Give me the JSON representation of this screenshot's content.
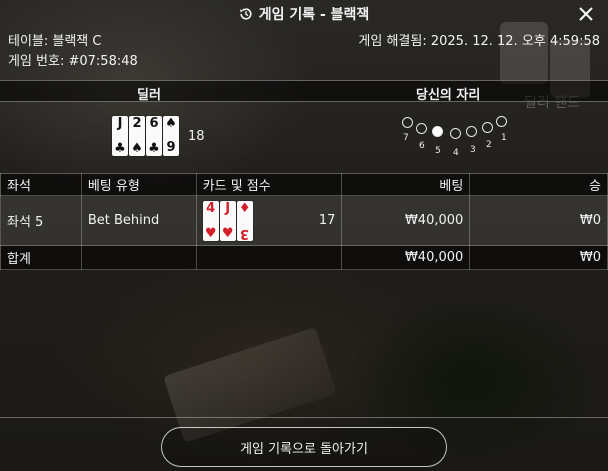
{
  "header": {
    "title": "게임 기록 - 블랙잭"
  },
  "info": {
    "table_label": "테이블: 블랙잭 C",
    "game_number": "게임 번호: #07:58:48",
    "resolved_at": "게임 해결됨: 2025. 12. 12. 오후 4:59:58"
  },
  "sections": {
    "dealer": "딜러",
    "your_seat": "당신의 자리"
  },
  "background_text": {
    "dealer_hand_ghost": "딜러 핸드"
  },
  "dealer": {
    "cards": [
      {
        "rank": "J",
        "suit": "♣",
        "color": "black"
      },
      {
        "rank": "2",
        "suit": "♠",
        "color": "black"
      },
      {
        "rank": "6",
        "suit": "♣",
        "color": "black"
      },
      {
        "rank": "9",
        "suit": "♠",
        "color": "black"
      }
    ],
    "score": "18"
  },
  "seat_map": {
    "seats": [
      {
        "num": "7",
        "active": false
      },
      {
        "num": "6",
        "active": false
      },
      {
        "num": "5",
        "active": true
      },
      {
        "num": "4",
        "active": false
      },
      {
        "num": "3",
        "active": false
      },
      {
        "num": "2",
        "active": false
      },
      {
        "num": "1",
        "active": false
      }
    ]
  },
  "table": {
    "headers": {
      "seat": "좌석",
      "bet_type": "베팅 유형",
      "cards_score": "카드 및 점수",
      "bet": "베팅",
      "win": "승"
    },
    "row": {
      "seat": "좌석 5",
      "bet_type": "Bet Behind",
      "cards": [
        {
          "rank": "4",
          "suit": "♥",
          "color": "red"
        },
        {
          "rank": "J",
          "suit": "♥",
          "color": "red"
        },
        {
          "rank": "3",
          "suit": "♦",
          "color": "red"
        }
      ],
      "score": "17",
      "bet": "₩40,000",
      "win": "₩0"
    },
    "total": {
      "label": "합계",
      "bet": "₩40,000",
      "win": "₩0"
    }
  },
  "footer": {
    "back_button": "게임 기록으로 돌아가기"
  },
  "colors": {
    "card_red": "#d41f2a",
    "card_black": "#111111"
  }
}
